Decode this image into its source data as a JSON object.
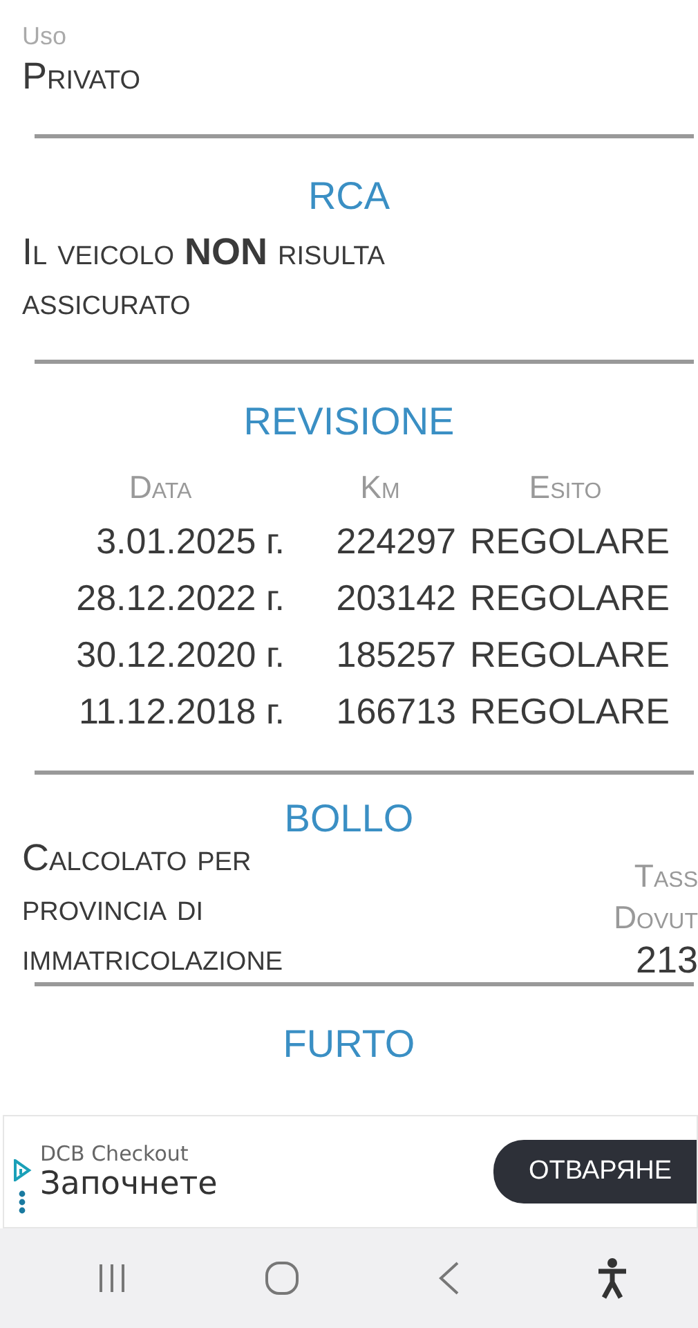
{
  "uso": {
    "label": "Uso",
    "value": "Privato"
  },
  "rca": {
    "title": "RCA",
    "text": "Il veicolo **NON** risulta assicurato"
  },
  "revisione": {
    "title": "REVISIONE",
    "columns": [
      "Data",
      "Km",
      "Esito"
    ],
    "rows": [
      {
        "data": "3.01.2025 г.",
        "km": "224297",
        "esito": "REGOLARE"
      },
      {
        "data": "28.12.2022 г.",
        "km": "203142",
        "esito": "REGOLARE"
      },
      {
        "data": "30.12.2020 г.",
        "km": "185257",
        "esito": "REGOLARE"
      },
      {
        "data": "11.12.2018 г.",
        "km": "166713",
        "esito": "REGOLARE"
      }
    ]
  },
  "bollo": {
    "title": "BOLLO",
    "text": "Calcolato per provincia di immatricolazione",
    "tax_label_1": "Tass",
    "tax_label_2": "Dovut",
    "amount": "213"
  },
  "furto": {
    "title": "FURTO"
  },
  "ad": {
    "advertiser": "DCB Checkout",
    "headline": "Започнете",
    "button": "ОТВАРЯНЕ"
  }
}
